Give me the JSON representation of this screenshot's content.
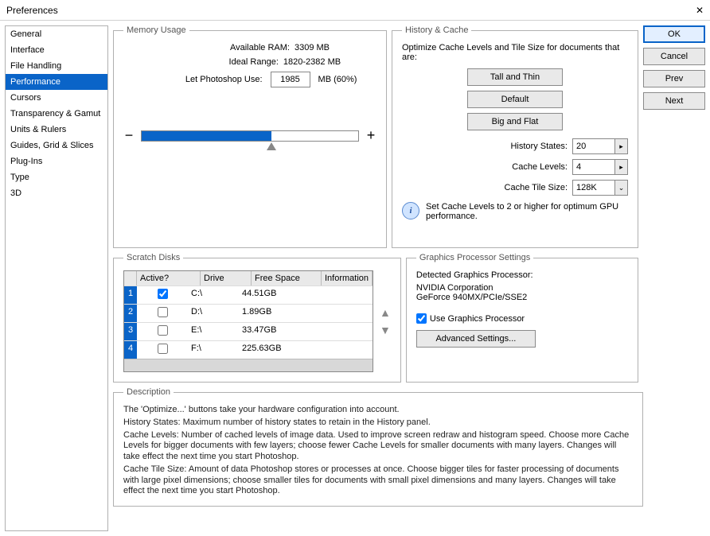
{
  "window": {
    "title": "Preferences",
    "close": "✕"
  },
  "sidebar": {
    "items": [
      "General",
      "Interface",
      "File Handling",
      "Performance",
      "Cursors",
      "Transparency & Gamut",
      "Units & Rulers",
      "Guides, Grid & Slices",
      "Plug-Ins",
      "Type",
      "3D"
    ],
    "selected": 3
  },
  "buttons": {
    "ok": "OK",
    "cancel": "Cancel",
    "prev": "Prev",
    "next": "Next"
  },
  "memory": {
    "legend": "Memory Usage",
    "avail_label": "Available RAM:",
    "avail_val": "3309 MB",
    "ideal_label": "Ideal Range:",
    "ideal_val": "1820-2382 MB",
    "let_label": "Let Photoshop Use:",
    "let_val": "1985",
    "let_suffix": "MB (60%)",
    "minus": "−",
    "plus": "+",
    "fill_pct": "60%"
  },
  "history": {
    "legend": "History & Cache",
    "intro": "Optimize Cache Levels and Tile Size for documents that are:",
    "btn_tall": "Tall and Thin",
    "btn_default": "Default",
    "btn_big": "Big and Flat",
    "states_label": "History States:",
    "states_val": "20",
    "levels_label": "Cache Levels:",
    "levels_val": "4",
    "tile_label": "Cache Tile Size:",
    "tile_val": "128K",
    "info": "Set Cache Levels to 2 or higher for optimum GPU performance."
  },
  "scratch": {
    "legend": "Scratch Disks",
    "head": {
      "active": "Active?",
      "drive": "Drive",
      "free": "Free Space",
      "info": "Information"
    },
    "rows": [
      {
        "n": "1",
        "active": true,
        "drive": "C:\\",
        "free": "44.51GB",
        "info": ""
      },
      {
        "n": "2",
        "active": false,
        "drive": "D:\\",
        "free": "1.89GB",
        "info": ""
      },
      {
        "n": "3",
        "active": false,
        "drive": "E:\\",
        "free": "33.47GB",
        "info": ""
      },
      {
        "n": "4",
        "active": false,
        "drive": "F:\\",
        "free": "225.63GB",
        "info": ""
      }
    ],
    "up": "▲",
    "down": "▼"
  },
  "gpu": {
    "legend": "Graphics Processor Settings",
    "detected_label": "Detected Graphics Processor:",
    "vendor": "NVIDIA Corporation",
    "card": "GeForce 940MX/PCIe/SSE2",
    "use_label": "Use Graphics Processor",
    "adv": "Advanced Settings..."
  },
  "desc": {
    "legend": "Description",
    "p1": "The 'Optimize...' buttons take your hardware configuration into account.",
    "p2": "History States: Maximum number of history states to retain in the History panel.",
    "p3": "Cache Levels: Number of cached levels of image data.  Used to improve screen redraw and histogram speed.  Choose more Cache Levels for bigger documents with few layers; choose fewer Cache Levels for smaller documents with many layers. Changes will take effect the next time you start Photoshop.",
    "p4": "Cache Tile Size: Amount of data Photoshop stores or processes at once. Choose bigger tiles for faster processing of documents with large pixel dimensions; choose smaller tiles for documents with small pixel dimensions and many layers. Changes will take effect the next time you start Photoshop."
  }
}
